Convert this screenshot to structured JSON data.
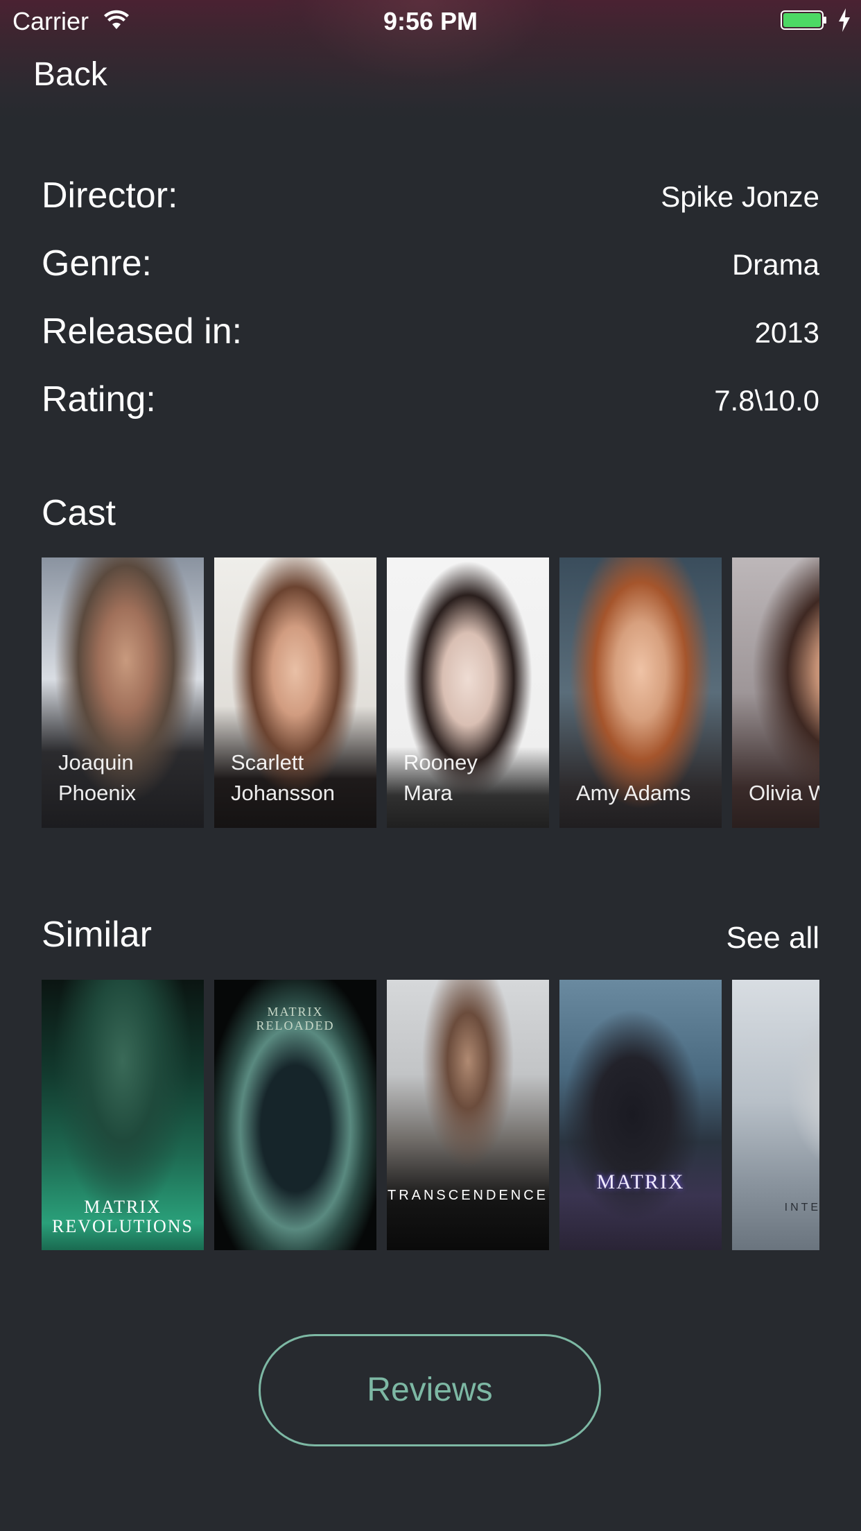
{
  "status_bar": {
    "carrier": "Carrier",
    "time": "9:56 PM"
  },
  "nav": {
    "back_label": "Back"
  },
  "details": [
    {
      "label": "Director:",
      "value": "Spike Jonze"
    },
    {
      "label": "Genre:",
      "value": "Drama"
    },
    {
      "label": "Released in:",
      "value": "2013"
    },
    {
      "label": "Rating:",
      "value": "7.8\\10.0"
    }
  ],
  "cast": {
    "title": "Cast",
    "members": [
      {
        "name": "Joaquin\nPhoenix"
      },
      {
        "name": "Scarlett\nJohansson"
      },
      {
        "name": "Rooney\nMara"
      },
      {
        "name": "Amy Adams"
      },
      {
        "name": "Olivia W"
      }
    ]
  },
  "similar": {
    "title": "Similar",
    "see_all_label": "See all",
    "posters": [
      {
        "title_line1": "MATRIX",
        "title_line2": "REVOLUTIONS"
      },
      {
        "title_line1": "MATRIX",
        "title_line2": "RELOADED"
      },
      {
        "title_line1": "TRANSCENDENCE",
        "title_line2": ""
      },
      {
        "title_line1": "MATRIX",
        "title_line2": ""
      },
      {
        "title_line1": "INTERS",
        "title_line2": ""
      }
    ]
  },
  "reviews_button": {
    "label": "Reviews"
  },
  "colors": {
    "background": "#272a2f",
    "accent": "#7db8a4",
    "battery": "#4cd964"
  }
}
